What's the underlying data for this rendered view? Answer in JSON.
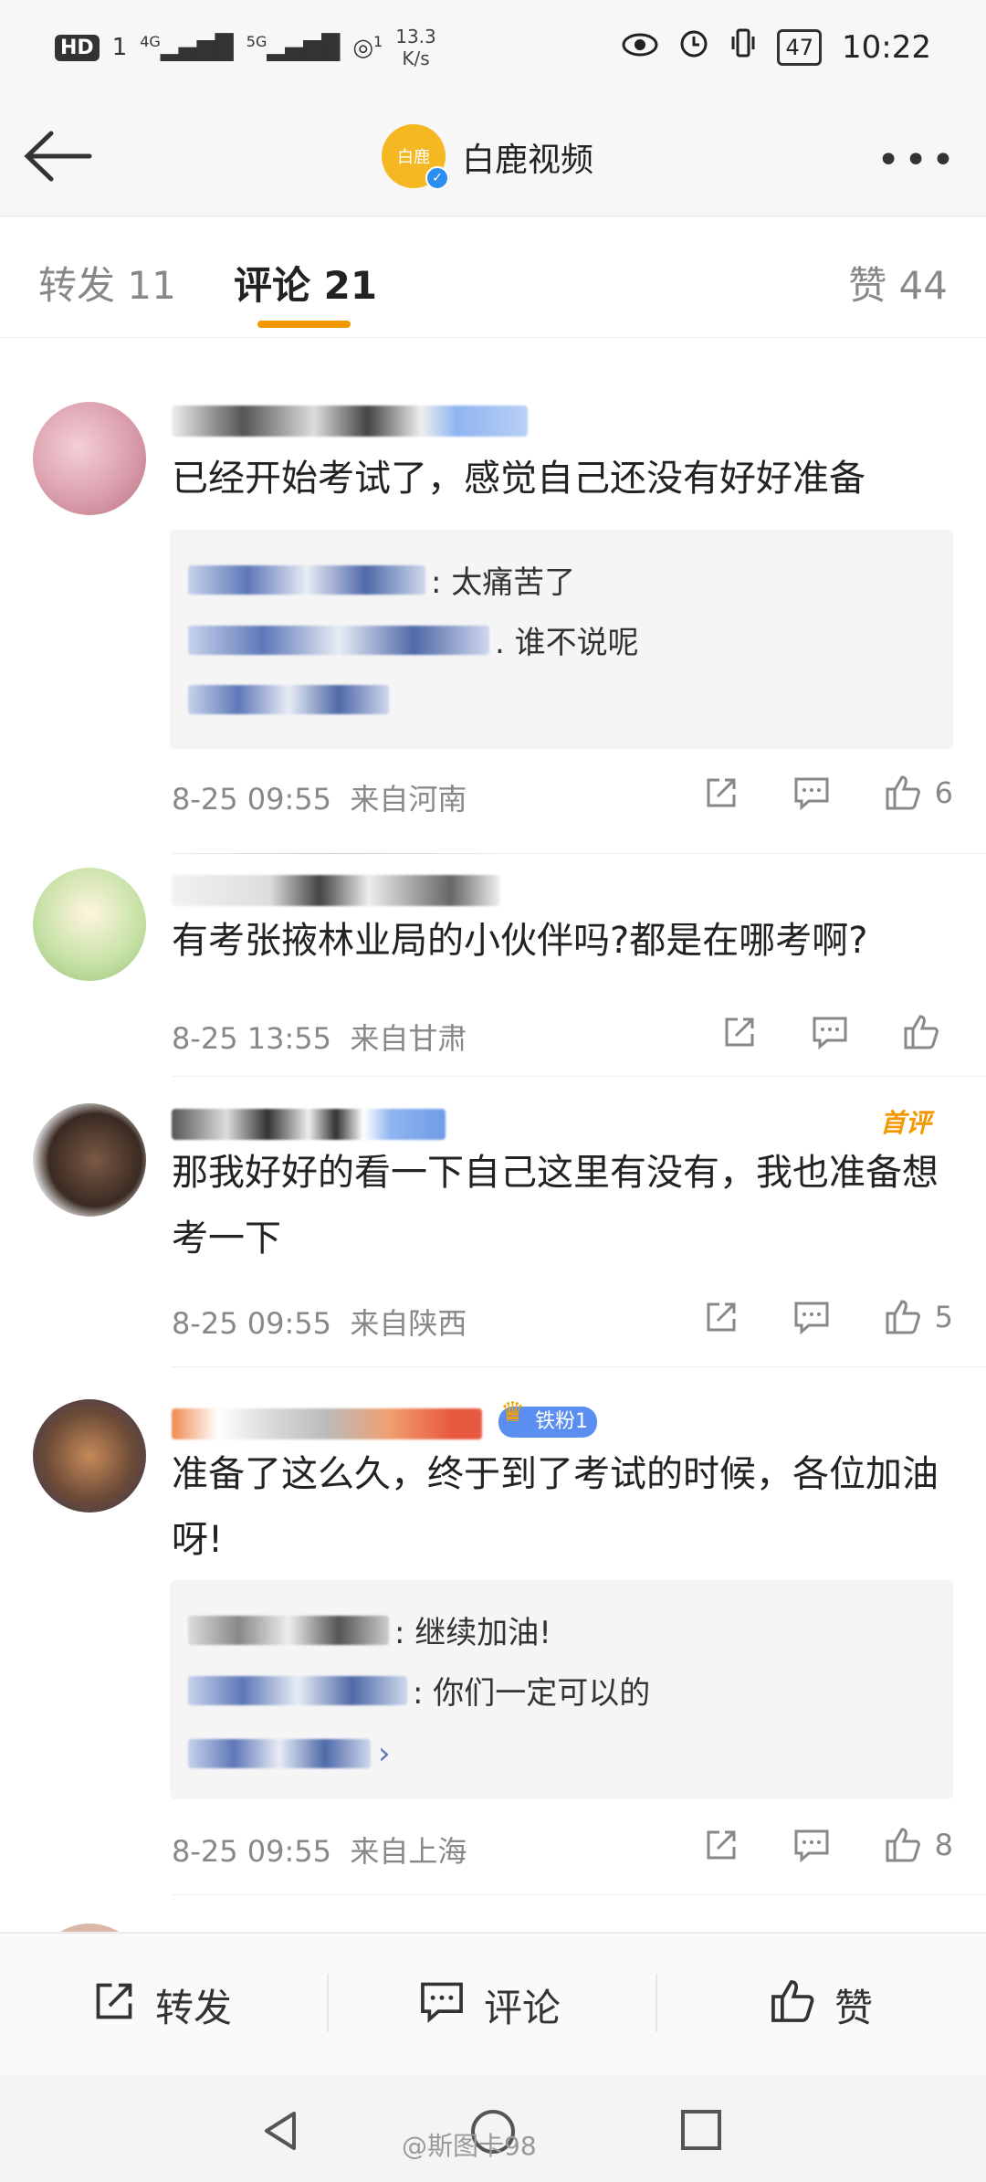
{
  "status_bar": {
    "hd": "HD",
    "sim": "1",
    "net1": "4G",
    "net2": "5G",
    "hotspot_count": "1",
    "speed_value": "13.3",
    "speed_unit": "K/s",
    "battery": "47",
    "time": "10:22"
  },
  "header": {
    "logo_text": "白鹿",
    "account_name": "白鹿视频",
    "more_label": "•••"
  },
  "tabs": [
    {
      "label": "转发 11"
    },
    {
      "label": "评论 21"
    },
    {
      "label": "赞 44"
    }
  ],
  "comments": [
    {
      "text": "已经开始考试了，感觉自己还没有好好准备",
      "replies": [
        ": 太痛苦了",
        ". 谁不说呢"
      ],
      "date": "8-25 09:55",
      "location": "来自河南",
      "likes": "6"
    },
    {
      "text": "有考张掖林业局的小伙伴吗?都是在哪考啊?",
      "replies": [],
      "date": "8-25 13:55",
      "location": "来自甘肃",
      "likes": ""
    },
    {
      "text": "那我好好的看一下自己这里有没有，我也准备想考一下",
      "badge": "首评",
      "replies": [],
      "date": "8-25 09:55",
      "location": "来自陕西",
      "likes": "5"
    },
    {
      "text": "准备了这么久，终于到了考试的时候，各位加油呀!",
      "fan_badge": "铁粉1",
      "replies": [
        ": 继续加油!",
        ": 你们一定可以的"
      ],
      "date": "8-25 09:55",
      "location": "来自上海",
      "likes": "8"
    }
  ],
  "bottom_bar": {
    "repost": "转发",
    "comment": "评论",
    "like": "赞"
  },
  "watermark": "@斯图卡98",
  "colors": {
    "accent": "#f39800",
    "verified": "#2c8ef0"
  }
}
